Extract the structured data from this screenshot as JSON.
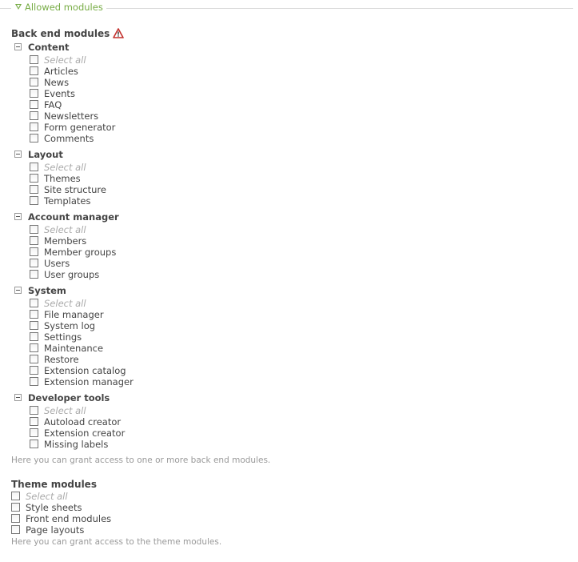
{
  "fieldset": {
    "legend": "Allowed modules"
  },
  "backend": {
    "heading": "Back end modules",
    "groups": [
      {
        "title": "Content",
        "items": [
          "Select all",
          "Articles",
          "News",
          "Events",
          "FAQ",
          "Newsletters",
          "Form generator",
          "Comments"
        ]
      },
      {
        "title": "Layout",
        "items": [
          "Select all",
          "Themes",
          "Site structure",
          "Templates"
        ]
      },
      {
        "title": "Account manager",
        "items": [
          "Select all",
          "Members",
          "Member groups",
          "Users",
          "User groups"
        ]
      },
      {
        "title": "System",
        "items": [
          "Select all",
          "File manager",
          "System log",
          "Settings",
          "Maintenance",
          "Restore",
          "Extension catalog",
          "Extension manager"
        ]
      },
      {
        "title": "Developer tools",
        "items": [
          "Select all",
          "Autoload creator",
          "Extension creator",
          "Missing labels"
        ]
      }
    ],
    "help": "Here you can grant access to one or more back end modules."
  },
  "theme": {
    "heading": "Theme modules",
    "items": [
      "Select all",
      "Style sheets",
      "Front end modules",
      "Page layouts"
    ],
    "help": "Here you can grant access to the theme modules."
  }
}
